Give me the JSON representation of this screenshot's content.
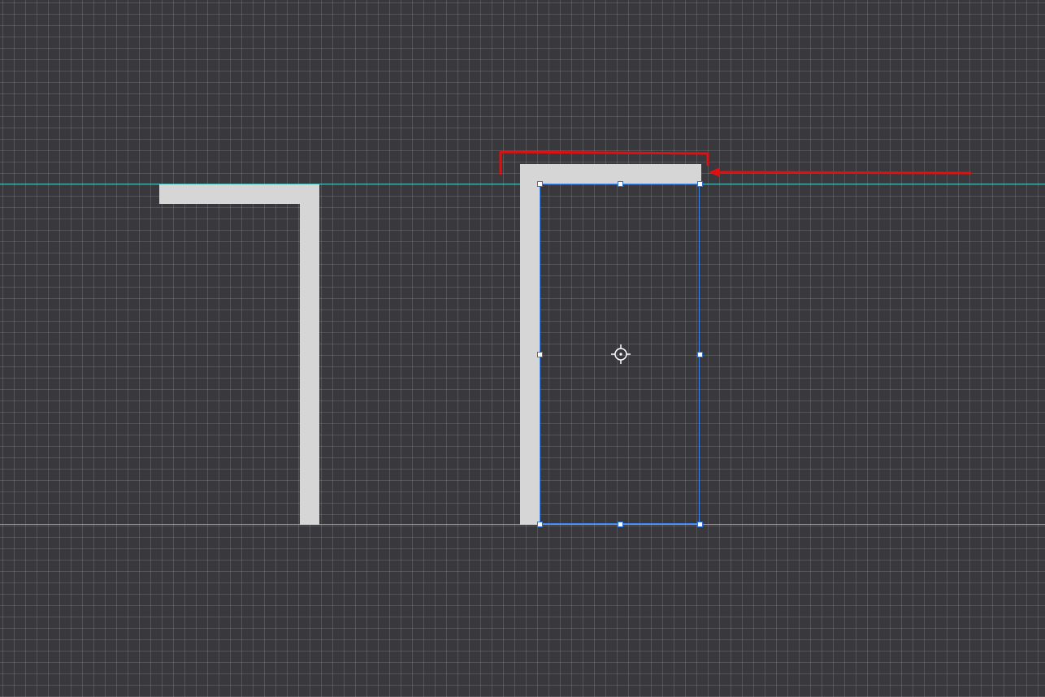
{
  "canvas": {
    "background": "#38383d",
    "grid_color": "#5a5a60",
    "guide_color": "#4fd0c8",
    "wall_color": "#d6d6d6",
    "selection_color": "#3b82e6",
    "annotation_color": "#e01010"
  },
  "tools": {
    "pivot_icon": "crosshair-pivot-icon",
    "annotation_arrow": "red-arrow-annotation",
    "annotation_bracket": "red-bracket-annotation"
  }
}
